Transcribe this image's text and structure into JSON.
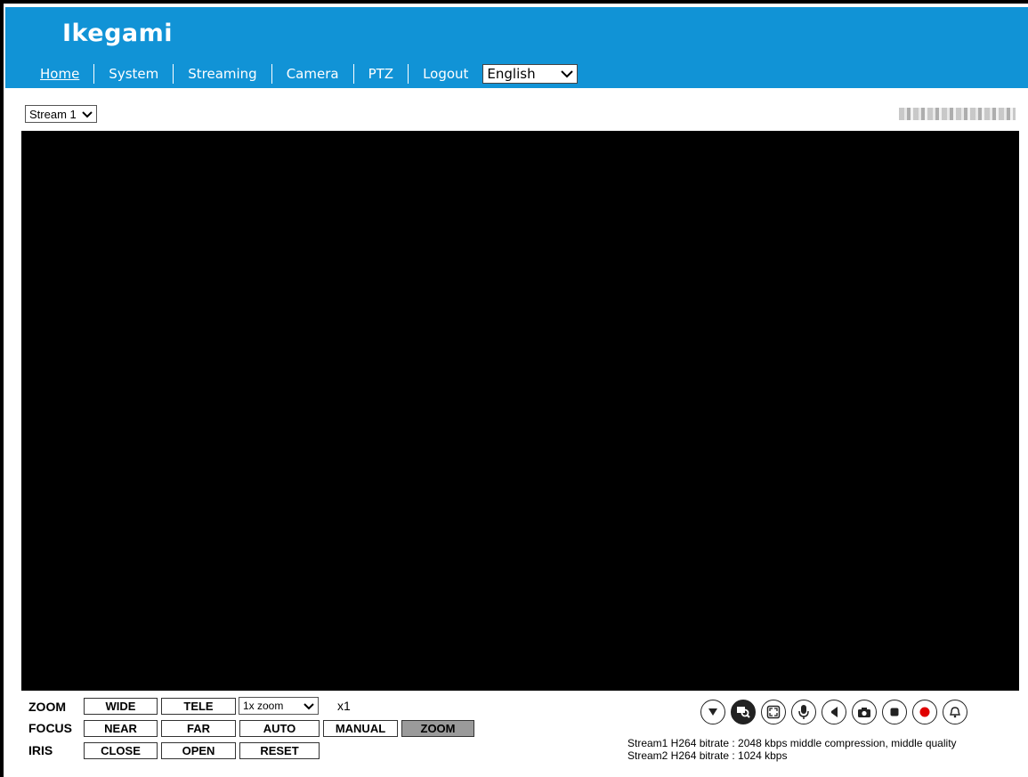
{
  "header": {
    "logo": "Ikegami",
    "nav": [
      "Home",
      "System",
      "Streaming",
      "Camera",
      "PTZ",
      "Logout"
    ],
    "language": "English"
  },
  "stream_select": "Stream 1",
  "controls": {
    "zoom_label": "ZOOM",
    "focus_label": "FOCUS",
    "iris_label": "IRIS",
    "wide": "WIDE",
    "tele": "TELE",
    "zoom_select": "1x zoom",
    "multiplier": "x1",
    "near": "NEAR",
    "far": "FAR",
    "auto": "AUTO",
    "manual": "MANUAL",
    "zoom_btn": "ZOOM",
    "close": "CLOSE",
    "open": "OPEN",
    "reset": "RESET"
  },
  "toolbar_icons": [
    "dropdown-icon",
    "magnify-icon",
    "fullscreen-icon",
    "microphone-icon",
    "speaker-icon",
    "snapshot-icon",
    "stop-icon",
    "record-icon",
    "alarm-icon"
  ],
  "info": {
    "line1": "Stream1 H264 bitrate : 2048 kbps middle compression, middle quality",
    "line2": "Stream2 H264 bitrate : 1024 kbps"
  },
  "colors": {
    "header": "#1193d6",
    "record": "#e00000"
  }
}
